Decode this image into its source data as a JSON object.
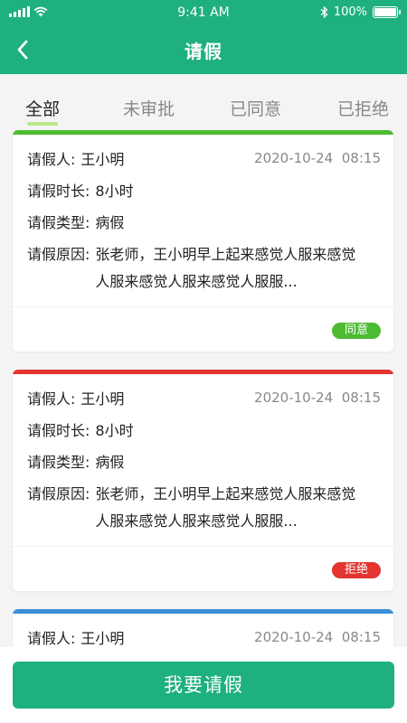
{
  "status_bar": {
    "time": "9:41 AM",
    "battery": "100%",
    "battery_level": 1.0
  },
  "header": {
    "title": "请假",
    "back_icon": "chevron-left-icon"
  },
  "tabs": [
    {
      "label": "全部",
      "active": true
    },
    {
      "label": "未审批",
      "active": false
    },
    {
      "label": "已同意",
      "active": false
    },
    {
      "label": "已拒绝",
      "active": false
    }
  ],
  "cards": [
    {
      "accent_color": "#4cbb32",
      "applicant_label": "请假人:",
      "applicant": "王小明",
      "date": "2020-10-24",
      "time": "08:15",
      "duration_label": "请假时长:",
      "duration": "8小时",
      "type_label": "请假类型:",
      "type": "病假",
      "reason_label": "请假原因:",
      "reason": "张老师，王小明早上起来感觉人服来感觉人服来感觉人服来感觉人服服...",
      "status": "同意",
      "status_color": "#4cbb32"
    },
    {
      "accent_color": "#e3342f",
      "applicant_label": "请假人:",
      "applicant": "王小明",
      "date": "2020-10-24",
      "time": "08:15",
      "duration_label": "请假时长:",
      "duration": "8小时",
      "type_label": "请假类型:",
      "type": "病假",
      "reason_label": "请假原因:",
      "reason": "张老师，王小明早上起来感觉人服来感觉人服来感觉人服来感觉人服服...",
      "status": "拒绝",
      "status_color": "#e3342f"
    },
    {
      "accent_color": "#3b8fd9",
      "applicant_label": "请假人:",
      "applicant": "王小明",
      "date": "2020-10-24",
      "time": "08:15"
    }
  ],
  "bottom": {
    "apply_label": "我要请假"
  },
  "colors": {
    "primary": "#1fb07f",
    "tab_underline": "#b8e986"
  }
}
